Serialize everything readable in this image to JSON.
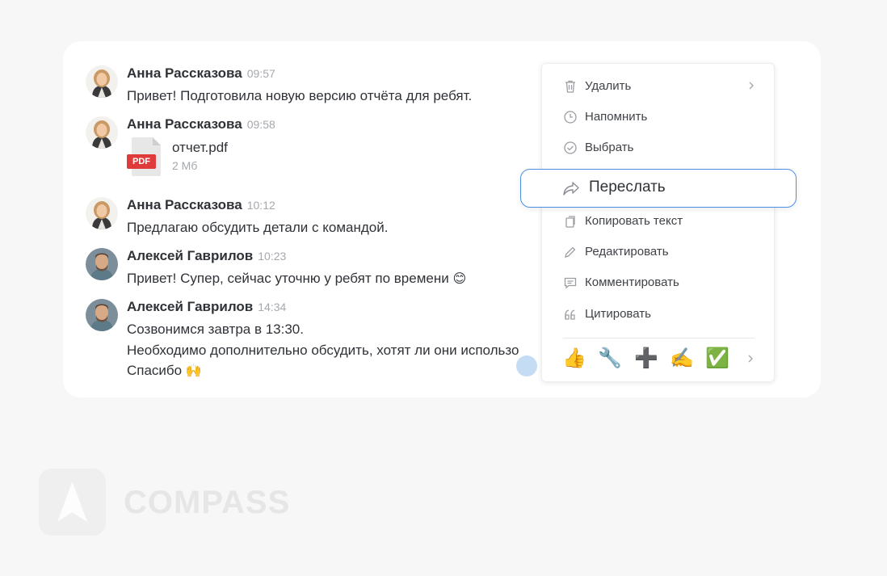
{
  "messages": [
    {
      "author": "Анна Рассказова",
      "time": "09:57",
      "text": "Привет! Подготовила новую версию отчёта для ребят."
    },
    {
      "author": "Анна Рассказова",
      "time": "09:58",
      "file": {
        "name": "отчет.pdf",
        "size": "2 Мб",
        "badge": "PDF"
      }
    },
    {
      "author": "Анна Рассказова",
      "time": "10:12",
      "text": "Предлагаю обсудить детали с командой."
    },
    {
      "author": "Алексей Гаврилов",
      "time": "10:23",
      "text": "Привет! Супер, сейчас уточню у ребят по времени",
      "emoji": "😊"
    },
    {
      "author": "Алексей Гаврилов",
      "time": "14:34",
      "lines": [
        "Созвонимся завтра в 13:30.",
        "Необходимо дополнительно обсудить, хотят ли они использо"
      ],
      "last_line": "Спасибо",
      "emoji": "🙌"
    }
  ],
  "context_menu": {
    "items": [
      {
        "label": "Удалить",
        "icon": "trash-icon"
      },
      {
        "label": "Напомнить",
        "icon": "clock-icon"
      },
      {
        "label": "Выбрать",
        "icon": "check-circle-icon"
      },
      {
        "label": "Переслать",
        "icon": "forward-arrow-icon"
      },
      {
        "label": "Копировать текст",
        "icon": "copy-icon"
      },
      {
        "label": "Редактировать",
        "icon": "pencil-icon"
      },
      {
        "label": "Комментировать",
        "icon": "comment-icon"
      },
      {
        "label": "Цитировать",
        "icon": "quote-icon"
      }
    ],
    "reactions": [
      "👍",
      "🔧",
      "➕",
      "✍️",
      "✅"
    ]
  },
  "brand": {
    "name": "COMPASS",
    "accent": "#4a90e2"
  }
}
